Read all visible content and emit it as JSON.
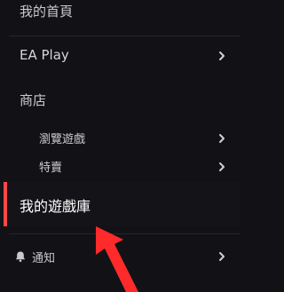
{
  "nav": {
    "items": [
      {
        "label": "我的首頁"
      },
      {
        "label": "EA Play"
      },
      {
        "label": "商店"
      },
      {
        "label": "瀏覽遊戲"
      },
      {
        "label": "特賣"
      },
      {
        "label": "我的遊戲庫"
      },
      {
        "label": "通知"
      }
    ]
  },
  "colors": {
    "background": "#121216",
    "accent": "#ff4747",
    "text_primary": "#ffffff",
    "text_muted": "#c9c9cf",
    "annotation_arrow": "#ff2a2a"
  },
  "icons": {
    "chevron": "chevron-right-icon",
    "notifications": "bell-icon",
    "annotation": "red-pointer-arrow"
  }
}
